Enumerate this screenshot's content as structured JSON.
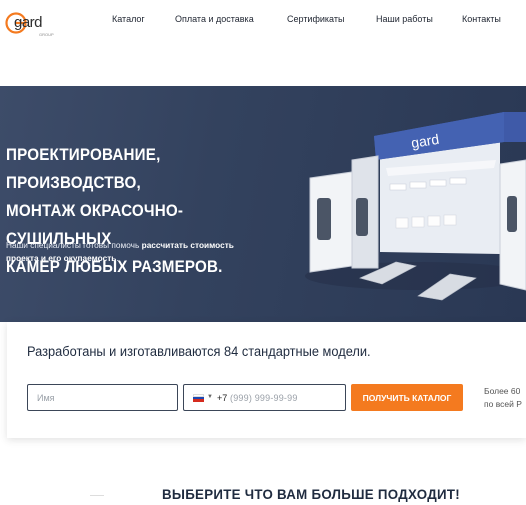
{
  "header": {
    "logo_text": "gard",
    "logo_sub": "GROUP",
    "nav": [
      "Каталог",
      "Оплата и доставка",
      "Сертификаты",
      "Наши работы",
      "Контакты"
    ]
  },
  "hero": {
    "title_lines": [
      "ПРОЕКТИРОВАНИЕ, ПРОИЗВОДСТВО,",
      "МОНТАЖ ОКРАСОЧНО-СУШИЛЬНЫХ",
      "КАМЕР ЛЮБЫХ РАЗМЕРОВ."
    ],
    "subtitle_plain_1": "Наши специалисты готовы помочь ",
    "subtitle_bold_1": "рассчитать стоимость",
    "subtitle_bold_2": "проекта и его окупаемость",
    "subtitle_end": ".",
    "booth_logo": "gard"
  },
  "form": {
    "title": "Разработаны и изготавливаются 84 стандартные модели.",
    "name_placeholder": "Имя",
    "phone_code": "+7",
    "phone_placeholder": "(999) 999-99-99",
    "submit_label": "ПОЛУЧИТЬ КАТАЛОГ",
    "side_note_1": "Более 60",
    "side_note_2": "по всей Р"
  },
  "next_section": {
    "title": "ВЫБЕРИТЕ ЧТО ВАМ БОЛЬШЕ ПОДХОДИТ!"
  },
  "colors": {
    "accent": "#f47a1f",
    "hero_bg": "#2f3d57",
    "booth_header": "#3f5aa8",
    "logo_orange": "#f47a1f",
    "logo_blue": "#3f7fd0"
  }
}
